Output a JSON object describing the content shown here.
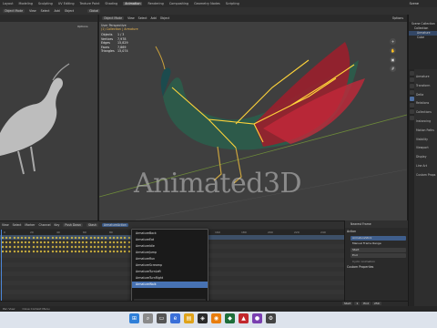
{
  "app": {
    "menus": [
      "File",
      "Edit",
      "Render",
      "Window",
      "Help"
    ],
    "workspaces": [
      "Layout",
      "Modeling",
      "Sculpting",
      "UV Editing",
      "Texture Paint",
      "Shading",
      "Animation",
      "Rendering",
      "Compositing",
      "Geometry Nodes",
      "Scripting"
    ],
    "active_workspace": "Animation",
    "scene_label": "Scene"
  },
  "toolbar": {
    "mode": "Object Mode",
    "items": [
      "View",
      "Select",
      "Add",
      "Object"
    ],
    "transform": "Global",
    "options": "Options"
  },
  "viewport": {
    "perspective": "User Perspective",
    "collection": "(1) Collection | Armature",
    "stats": [
      {
        "label": "Objects",
        "value": "1 / 3"
      },
      {
        "label": "Vertices",
        "value": "7,978"
      },
      {
        "label": "Edges",
        "value": "15,829"
      },
      {
        "label": "Faces",
        "value": "7,869"
      },
      {
        "label": "Triangles",
        "value": "15,074"
      }
    ],
    "watermark": "Animated3D",
    "left_options": "Options"
  },
  "outliner": {
    "items": [
      "Scene Collection",
      "Collection",
      "Armature",
      "Cube"
    ]
  },
  "properties": {
    "lines": [
      "Armature",
      "Transform",
      "Delta",
      "Relations",
      "Collections",
      "Instancing",
      "Motion Paths",
      "Visibility",
      "Viewport Display",
      "Line Art",
      "Custom Props"
    ]
  },
  "dopesheet": {
    "menus": [
      "View",
      "Select",
      "Marker",
      "Channel",
      "Key"
    ],
    "push_down": "Push Down",
    "stash": "Stash",
    "action_name": "ArmatureAction",
    "ruler": [
      0,
      20,
      40,
      60,
      80,
      100,
      120,
      140,
      160,
      180,
      200,
      220,
      240
    ],
    "current_frame": "0",
    "keyed_rows": 4,
    "row_count": 14
  },
  "action_panel": {
    "nearest_frame": "Nearest Frame",
    "section_action": "Action",
    "action_value": "ArmatureStick",
    "manual_range": "Manual Frame Range",
    "start": "Start",
    "end": "End",
    "cyclic": "Cyclic Animation",
    "custom_props": "Custom Properties"
  },
  "dropdown": {
    "items": [
      "ArmatureBack",
      "ArmatureEat",
      "ArmatureIdle",
      "ArmatureJump",
      "ArmatureRun",
      "ArmatureScreamp",
      "ArmatureTurnLeft",
      "ArmatureTurnRight",
      "ArmatureWalk"
    ],
    "selected_index": 8,
    "search_placeholder": ""
  },
  "timeline": {
    "start_label": "Start",
    "start_value": "1",
    "end_label": "End",
    "end_value": "250"
  },
  "statusbar": {
    "items": [
      "Pan View",
      "Close Context Menu"
    ]
  },
  "taskbar": {
    "time": "",
    "date": ""
  }
}
